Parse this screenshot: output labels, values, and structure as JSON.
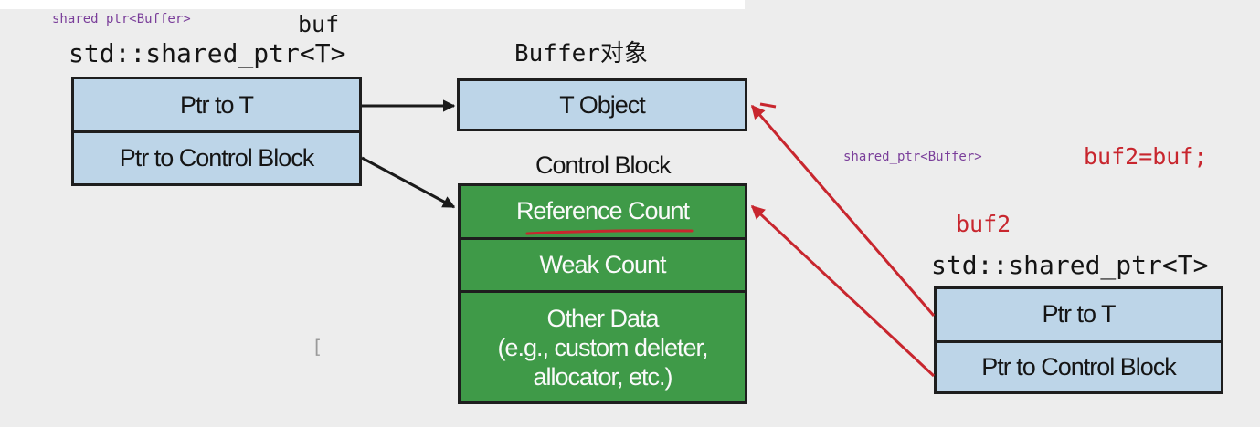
{
  "left_ptr": {
    "code_label": "shared_ptr<Buffer>",
    "var_name": "buf",
    "type_label": "std::shared_ptr<T>",
    "field_ptr_t": "Ptr to T",
    "field_ptr_cb": "Ptr to Control Block"
  },
  "object": {
    "title": "Buffer对象",
    "label": "T Object"
  },
  "control_block": {
    "title": "Control Block",
    "reference_count": "Reference Count",
    "weak_count": "Weak Count",
    "other_data_line1": "Other Data",
    "other_data_line2": "(e.g., custom deleter,",
    "other_data_line3": "allocator, etc.)"
  },
  "copy_statement": {
    "code_label": "shared_ptr<Buffer>",
    "code": "buf2=buf;"
  },
  "right_ptr": {
    "var_name": "buf2",
    "type_label": "std::shared_ptr<T>",
    "field_ptr_t": "Ptr to T",
    "field_ptr_cb": "Ptr to Control Block"
  },
  "stray_mark": "[",
  "colors": {
    "field_blue": "#bdd5e8",
    "block_green": "#3f9a48",
    "annotation_red": "#c8262e",
    "code_purple": "#7a3e9a",
    "background": "#ededed"
  }
}
